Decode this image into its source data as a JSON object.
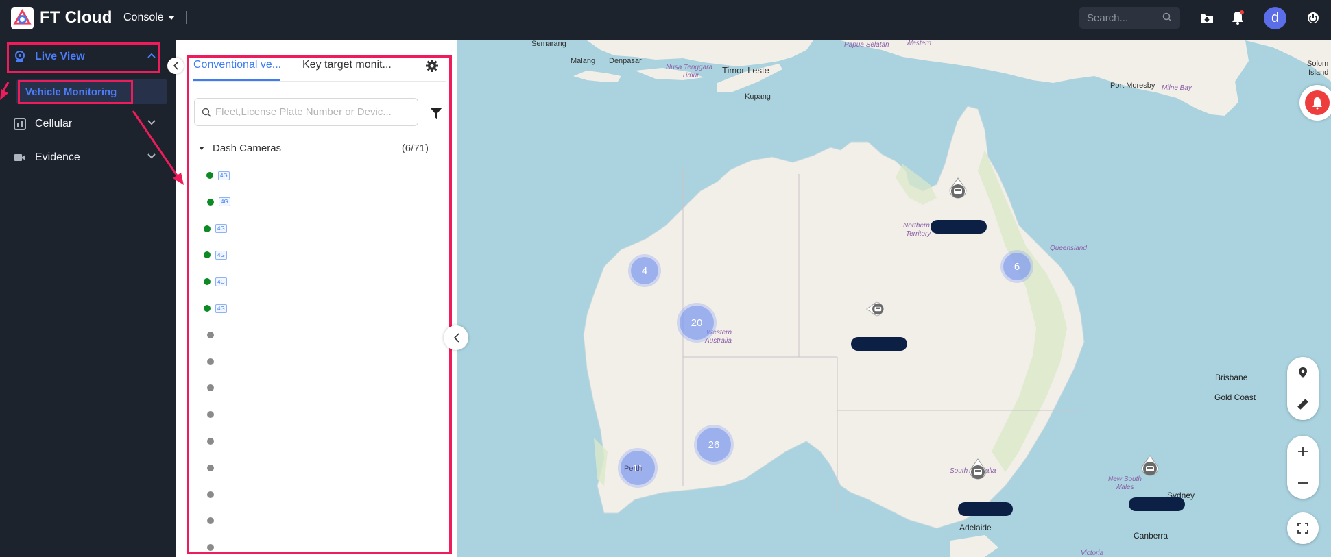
{
  "header": {
    "brand": "FT Cloud",
    "console_label": "Console",
    "search_placeholder": "Search..."
  },
  "user": {
    "avatar_letter": "d"
  },
  "sidebar": {
    "items": [
      {
        "label": "Live View",
        "icon": "camera-icon",
        "expanded": true
      },
      {
        "label": "Cellular",
        "icon": "cellular-icon",
        "expanded": false
      },
      {
        "label": "Evidence",
        "icon": "video-icon",
        "expanded": false
      }
    ],
    "sub_item": "Vehicle Monitoring"
  },
  "panel": {
    "tabs": [
      {
        "label": "Conventional ve...",
        "active": true
      },
      {
        "label": "Key target monit...",
        "active": false
      }
    ],
    "search_placeholder": "Fleet,License Plate Number or Devic...",
    "group": {
      "name": "Dash Cameras",
      "count": "(6/71)"
    },
    "devices": [
      {
        "status": "online",
        "network": "4G"
      },
      {
        "status": "online",
        "network": "4G"
      },
      {
        "status": "online",
        "network": "4G"
      },
      {
        "status": "online",
        "network": "4G"
      },
      {
        "status": "online",
        "network": "4G"
      },
      {
        "status": "online",
        "network": "4G"
      },
      {
        "status": "offline"
      },
      {
        "status": "offline"
      },
      {
        "status": "offline"
      },
      {
        "status": "offline"
      },
      {
        "status": "offline"
      },
      {
        "status": "offline"
      },
      {
        "status": "offline"
      },
      {
        "status": "offline"
      },
      {
        "status": "offline"
      }
    ]
  },
  "map": {
    "clusters": [
      "4",
      "20",
      "26",
      "11",
      "6"
    ],
    "labels": {
      "semarang": "Semarang",
      "malang": "Malang",
      "denpasar": "Denpasar",
      "nusa": "Nusa Tenggara",
      "timur": "Timur",
      "timorleste": "Timor-Leste",
      "kupang": "Kupang",
      "papua": "Papua Selatan",
      "western_top": "Western",
      "port_moresby": "Port Moresby",
      "milne_bay": "Milne Bay",
      "solomon": "Solom",
      "island": "Island",
      "nt1": "Northern",
      "nt2": "Territory",
      "queensland": "Queensland",
      "wa1": "Western",
      "wa2": "Australia",
      "sa": "South Australia",
      "nsw1": "New South",
      "nsw2": "Wales",
      "victoria": "Victoria",
      "brisbane": "Brisbane",
      "gold_coast": "Gold Coast",
      "sydney": "Sydney",
      "canberra": "Canberra",
      "adelaide": "Adelaide",
      "perth": "Perth"
    },
    "controls": [
      "location-pin-icon",
      "ruler-icon",
      "zoom-in-icon",
      "zoom-out-icon",
      "fullscreen-icon"
    ]
  },
  "colors": {
    "accent": "#3d7cf4",
    "highlight": "#ee1c5a",
    "online": "#0e8a25",
    "offline": "#8a8a8a",
    "sidebar_bg": "#1d232d",
    "water": "#aad3df",
    "land": "#f2efe9"
  }
}
